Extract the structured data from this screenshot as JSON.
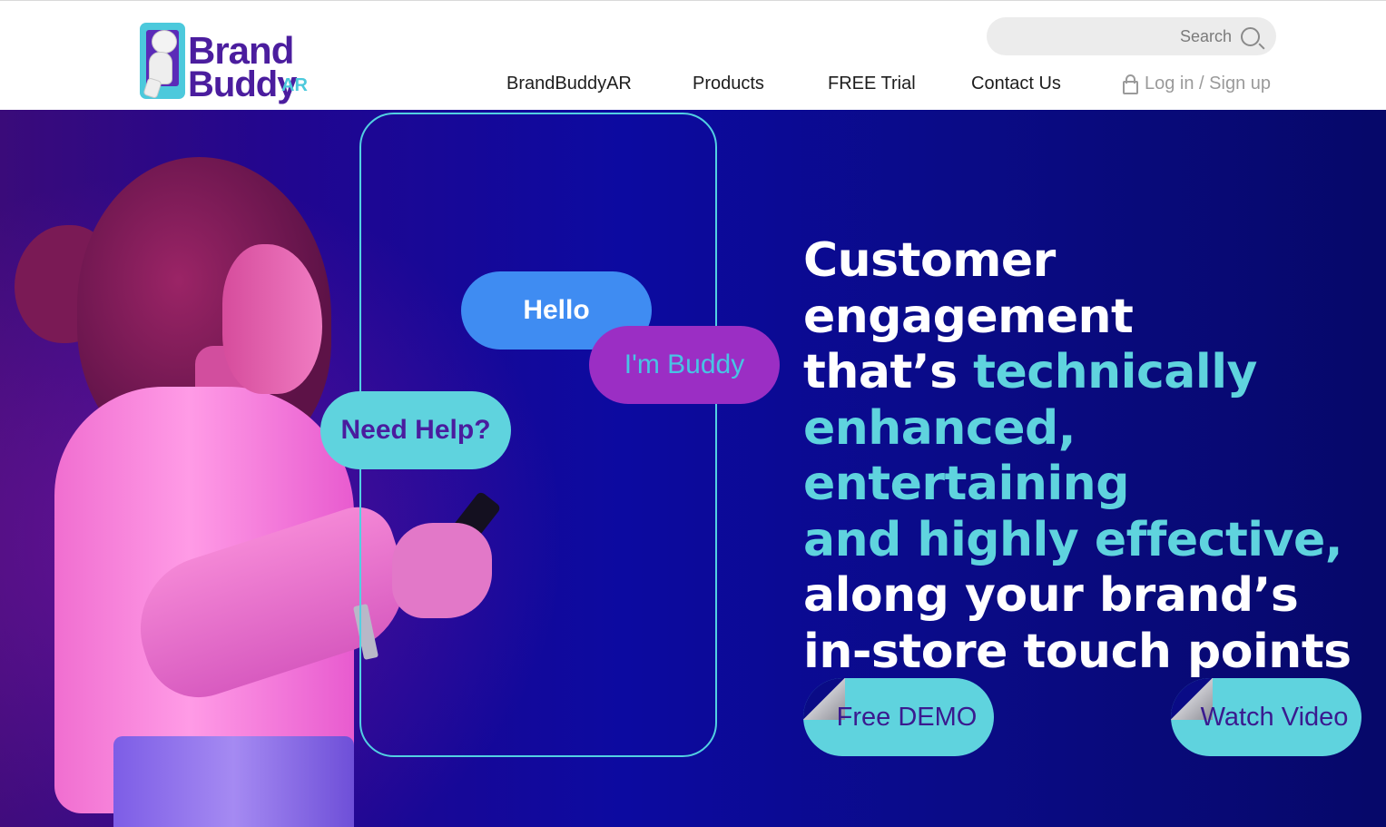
{
  "header": {
    "logo": {
      "line1": "Brand",
      "line2": "Buddy",
      "suffix": "AR"
    },
    "search": {
      "label": "Search"
    },
    "nav": [
      {
        "label": "BrandBuddyAR"
      },
      {
        "label": "Products"
      },
      {
        "label": "FREE Trial"
      },
      {
        "label": "Contact Us"
      }
    ],
    "login_label": "Log in / Sign up"
  },
  "hero": {
    "bubbles": {
      "hello": "Hello",
      "buddy": "I'm Buddy",
      "help": "Need Help?"
    },
    "headline": {
      "line1": "Customer engagement",
      "line2_prefix": "that’s ",
      "line2_accent": "technically",
      "line3": "enhanced, entertaining",
      "line4": "and highly effective,",
      "line5": "along your brand’s",
      "line6": "in-store touch points"
    },
    "cta": {
      "demo": "Free DEMO",
      "video": "Watch Video"
    }
  },
  "colors": {
    "brand_purple": "#4b1d9e",
    "accent_cyan": "#5fd3de",
    "hero_blue": "#0c0aa0",
    "bubble_blue": "#3f8cf2",
    "bubble_purple": "#9b2ec4"
  },
  "icons": [
    "search-icon",
    "lock-icon",
    "buddy-mascot-icon"
  ]
}
